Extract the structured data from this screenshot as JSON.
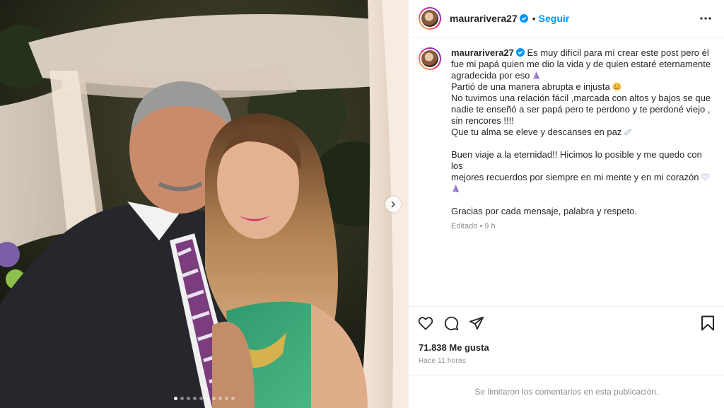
{
  "post": {
    "username": "maurarivera27",
    "follow_label": "Seguir",
    "separator": "•",
    "caption_lines": [
      "Es muy difícil para mí crear este post pero él",
      "fue mi papá quien me dio la vida y de quien estaré eternamente",
      "agradecida por eso",
      "Partió de una manera abrupta e injusta",
      "No tuvimos una relación fácil ,marcada con altos y bajos se que",
      "nadie te enseñó a ser papá pero te perdono y te perdoné viejo ,",
      "sin rencores !!!!",
      "Que tu alma se eleve y descanses en paz",
      "",
      "Buen viaje a la eternidad!! Hicimos lo posible y me quedo con los",
      "mejores recuerdos por siempre en mi mente y en mi corazón",
      "",
      "",
      "Gracias por cada mensaje, palabra y respeto."
    ],
    "edited_label": "Editado",
    "edited_time": "9 h",
    "likes": "71.838 Me gusta",
    "posted_ago": "Hace 11 horas",
    "comments_limited": "Se limitaron los comentarios en esta publicación.",
    "carousel": {
      "total": 10,
      "active": 1
    },
    "icons": {
      "verified": "verified-badge-icon",
      "more": "more-options-icon",
      "like": "heart-icon",
      "comment": "comment-icon",
      "share": "send-icon",
      "save": "bookmark-icon",
      "next": "chevron-right-icon"
    },
    "colors": {
      "accent": "#0095f6",
      "text": "#262626",
      "muted": "#8e8e8e",
      "border": "#efefef"
    }
  }
}
